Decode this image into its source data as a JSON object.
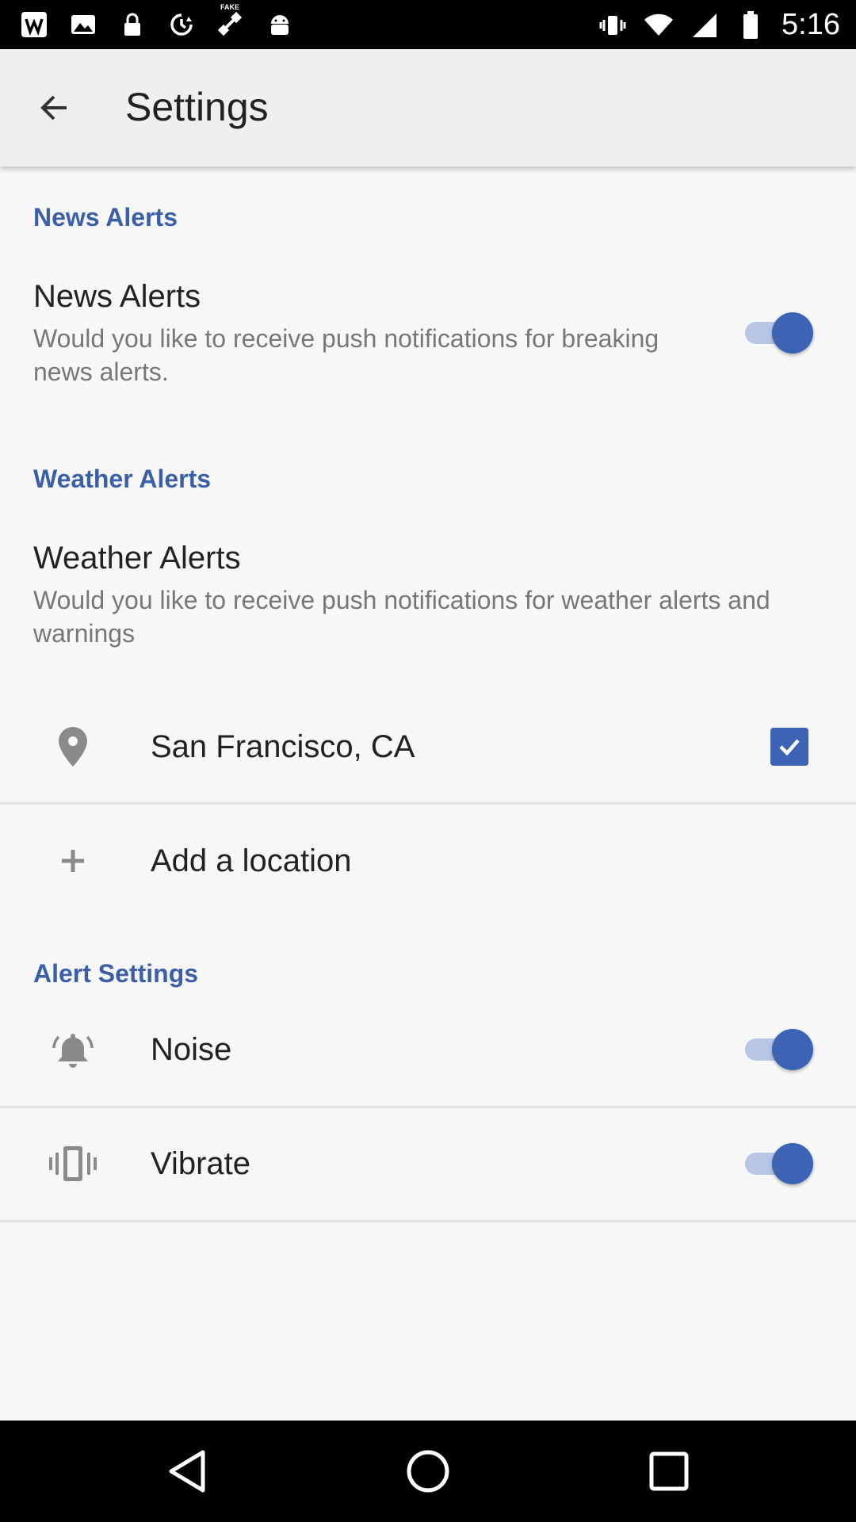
{
  "status_bar": {
    "time": "5:16",
    "icons": [
      "wordpress-icon",
      "photos-icon",
      "lock-icon",
      "sync-icon",
      "satellite-fake-gps-icon",
      "android-robot-icon",
      "vibrate-icon",
      "wifi-icon",
      "signal-icon",
      "battery-icon"
    ],
    "satellite_badge": "FAKE"
  },
  "app_bar": {
    "title": "Settings",
    "back_icon": "arrow-back-icon"
  },
  "news": {
    "header": "News Alerts",
    "title": "News Alerts",
    "summary": "Would you like to receive push notifications for breaking news alerts.",
    "enabled": true
  },
  "weather": {
    "header": "Weather Alerts",
    "title": "Weather Alerts",
    "summary": "Would you like to receive push notifications for weather alerts and warnings"
  },
  "locations": [
    {
      "label": "San Francisco, CA",
      "icon": "location-pin-icon",
      "checked": true
    }
  ],
  "add_location": {
    "label": "Add a location",
    "icon": "plus-icon"
  },
  "alert_settings": {
    "header": "Alert Settings",
    "noise": {
      "label": "Noise",
      "icon": "bell-icon",
      "enabled": true
    },
    "vibrate": {
      "label": "Vibrate",
      "icon": "vibrate-icon",
      "enabled": true
    }
  },
  "colors": {
    "accent": "#3d63b4",
    "header_text": "#3b5fa7",
    "app_bar": "#efefef",
    "background": "#f7f7f7"
  },
  "nav_bar": {
    "icons": [
      "back-triangle-icon",
      "home-circle-icon",
      "recents-square-icon"
    ]
  }
}
